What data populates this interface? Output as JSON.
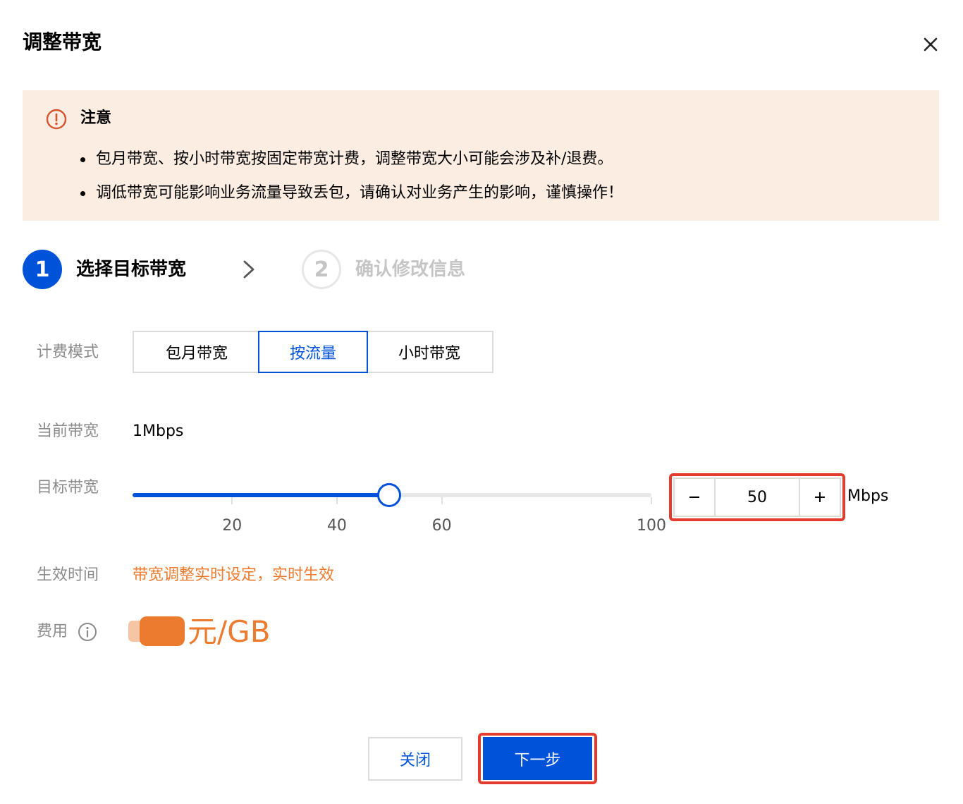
{
  "dialog": {
    "title": "调整带宽"
  },
  "notice": {
    "title": "注意",
    "items": [
      "包月带宽、按小时带宽按固定带宽计费，调整带宽大小可能会涉及补/退费。",
      "调低带宽可能影响业务流量导致丢包，请确认对业务产生的影响，谨慎操作！"
    ]
  },
  "steps": [
    {
      "number": "1",
      "label": "选择目标带宽",
      "state": "active"
    },
    {
      "number": "2",
      "label": "确认修改信息",
      "state": "inactive"
    }
  ],
  "form": {
    "billing_mode": {
      "label": "计费模式",
      "options": [
        "包月带宽",
        "按流量",
        "小时带宽"
      ],
      "selected": "按流量"
    },
    "current_bandwidth": {
      "label": "当前带宽",
      "value": "1Mbps"
    },
    "target_bandwidth": {
      "label": "目标带宽",
      "value": "50",
      "unit": "Mbps",
      "min": 1,
      "max": 100,
      "ticks": [
        "20",
        "40",
        "60",
        "100"
      ]
    },
    "effective_time": {
      "label": "生效时间",
      "text": "带宽调整实时设定，实时生效"
    },
    "fee": {
      "label": "费用",
      "unit": "元/GB"
    }
  },
  "footer": {
    "close_label": "关闭",
    "next_label": "下一步"
  },
  "colors": {
    "primary": "#0052d9",
    "warning": "#ed7b2f",
    "notice_bg": "#fcede2",
    "highlight": "#e33b2e"
  }
}
